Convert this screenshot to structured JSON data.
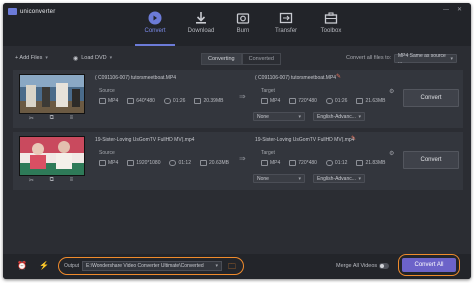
{
  "app": {
    "name": "uniconverter",
    "accent": "#6c7bd8",
    "highlight": "#f08b2c"
  },
  "nav": {
    "items": [
      {
        "label": "Convert",
        "icon": "convert-icon",
        "active": true
      },
      {
        "label": "Download",
        "icon": "download-icon",
        "active": false
      },
      {
        "label": "Burn",
        "icon": "burn-icon",
        "active": false
      },
      {
        "label": "Transfer",
        "icon": "transfer-icon",
        "active": false
      },
      {
        "label": "Toolbox",
        "icon": "toolbox-icon",
        "active": false
      }
    ]
  },
  "toolbar": {
    "add_files": "+ Add Files",
    "load_dvd": "Load DVD",
    "tab_converting": "Converting",
    "tab_converted": "Converted",
    "convert_all_to_label": "Convert all files to:",
    "convert_all_to_value": "MP4 Same as source ..."
  },
  "files": [
    {
      "source_name": "( C091106-007) tutorsmeetboat.MP4",
      "target_name": "( C091106-007) tutorsmeetboat.MP4",
      "source_label": "Source",
      "target_label": "Target",
      "source": {
        "format": "MP4",
        "resolution": "640*480",
        "duration": "01:26",
        "size": "20.39MB"
      },
      "target": {
        "format": "MP4",
        "resolution": "720*480",
        "duration": "01:26",
        "size": "21.63MB"
      },
      "subtitle": "None",
      "audio": "English-Advanc...",
      "convert_label": "Convert"
    },
    {
      "source_name": "19-Sister-Loving UsGomTV FullHD MV(.mp4",
      "target_name": "19-Sister-Loving UsGomTV FullHD MV(.mp4",
      "source_label": "Source",
      "target_label": "Target",
      "source": {
        "format": "MP4",
        "resolution": "1920*1080",
        "duration": "01:12",
        "size": "20.63MB"
      },
      "target": {
        "format": "MP4",
        "resolution": "720*480",
        "duration": "01:12",
        "size": "21.83MB"
      },
      "subtitle": "None",
      "audio": "English-Advanc...",
      "convert_label": "Convert"
    }
  ],
  "bottom": {
    "output_label": "Output",
    "output_path": "E:\\Wondershare Video Converter Ultimate\\Converted",
    "merge_label": "Merge All Videos",
    "convert_all_label": "Convert All"
  },
  "window_controls": {
    "min": "—",
    "close": "✕"
  }
}
